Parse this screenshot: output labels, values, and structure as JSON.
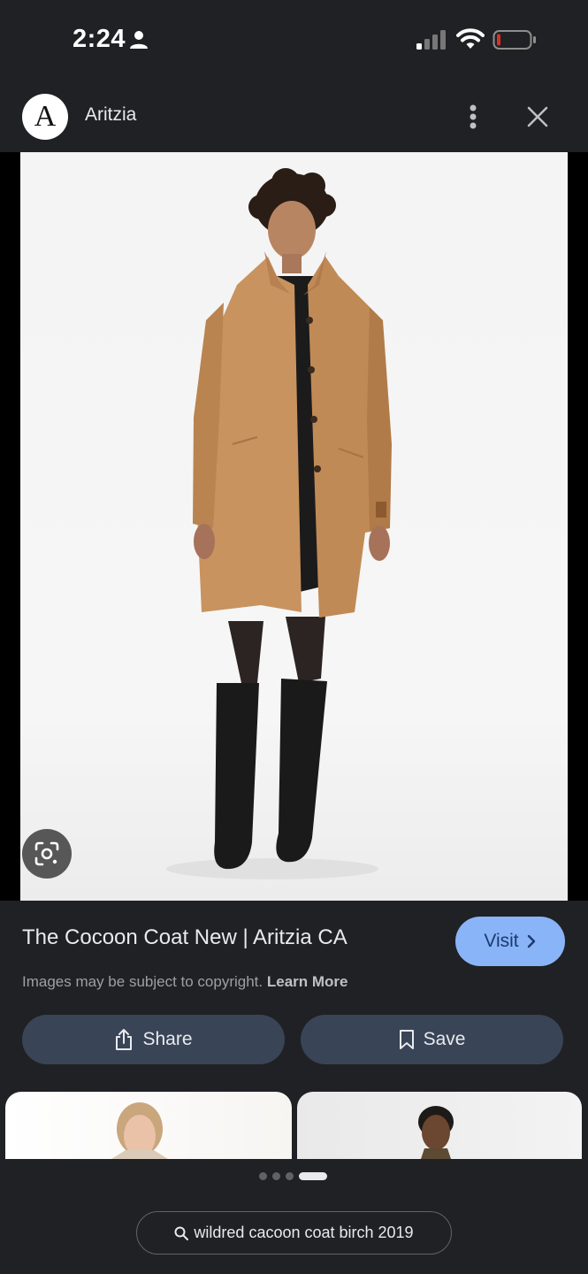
{
  "status_bar": {
    "time": "2:24",
    "battery_color": "#d93025"
  },
  "header": {
    "logo_letter": "A",
    "site_name": "Aritzia"
  },
  "result": {
    "title": "The Cocoon Coat New | Aritzia CA",
    "visit_label": "Visit",
    "copyright_text": "Images may be subject to copyright.",
    "learn_more_label": "Learn More",
    "share_label": "Share",
    "save_label": "Save"
  },
  "pagination": {
    "total_dots": 4,
    "active_index": 3
  },
  "search_chip": {
    "query": "wildred cacoon coat birch 2019"
  },
  "colors": {
    "background": "#202124",
    "accent": "#8ab4f8",
    "button_bg": "#394457"
  }
}
